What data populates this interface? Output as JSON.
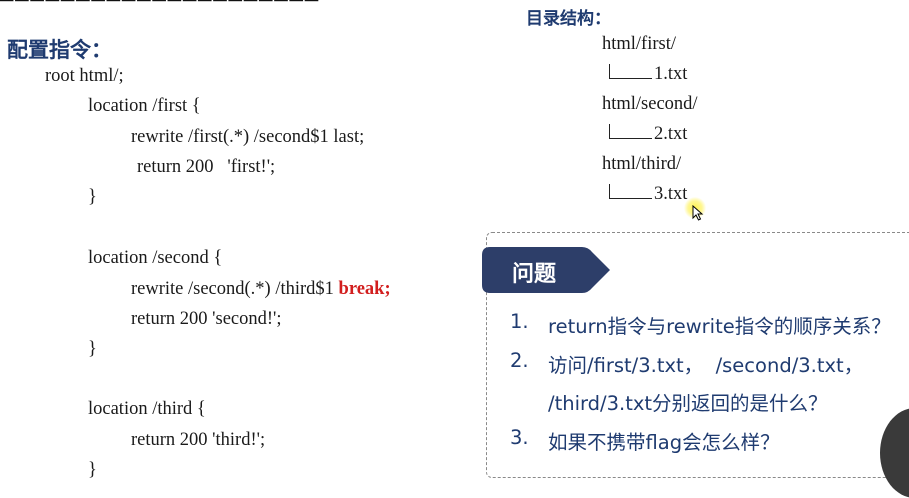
{
  "config_heading": "配置指令：",
  "code": {
    "root": "root html/;",
    "loc_first": "location /first {",
    "rewrite_first": "rewrite /first(.*) /second$1 last;",
    "return_first": "return 200   'first!';",
    "close_first": "}",
    "loc_second": "location /second {",
    "rewrite_second_prefix": "rewrite /second(.*) /third$1 ",
    "rewrite_second_flag": "break;",
    "return_second": "return 200 'second!';",
    "close_second": "}",
    "loc_third": "location /third {",
    "return_third": "return 200 'third!';",
    "close_third": "}"
  },
  "directory": {
    "heading": "目录结构：",
    "entries": [
      {
        "folder": "html/first/",
        "file": "1.txt"
      },
      {
        "folder": "html/second/",
        "file": "2.txt"
      },
      {
        "folder": "html/third/",
        "file": "3.txt"
      }
    ]
  },
  "questions": {
    "title": "问题",
    "items": [
      {
        "num": "1.",
        "text": "return指令与rewrite指令的顺序关系？"
      },
      {
        "num": "2.",
        "text": "访问/first/3.txt，  /second/3.txt，",
        "text2": "/third/3.txt分别返回的是什么？"
      },
      {
        "num": "3.",
        "text": "如果不携带flag会怎么样？"
      }
    ]
  },
  "colors": {
    "heading_blue": "#1f3b70",
    "break_red": "#d21e1e",
    "title_banner": "#2d3e69"
  }
}
